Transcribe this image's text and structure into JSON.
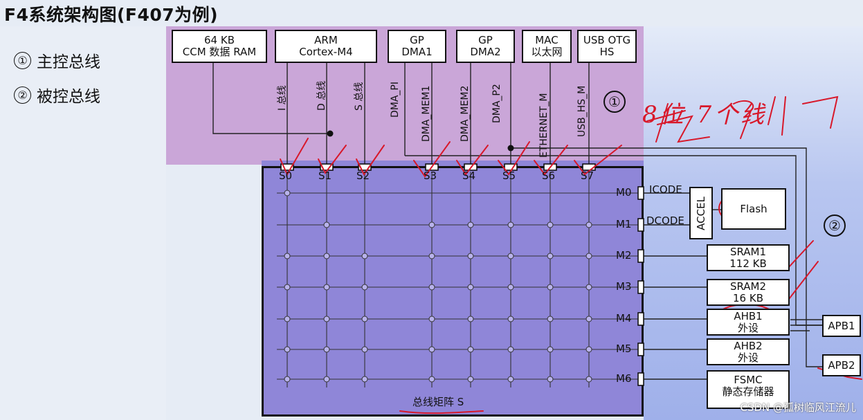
{
  "title": "F4系统架构图(F407为例)",
  "legend": [
    {
      "num": "①",
      "label": "主控总线"
    },
    {
      "num": "②",
      "label": "被控总线"
    }
  ],
  "masters": [
    {
      "line1": "64 KB",
      "line2": "CCM 数据 RAM"
    },
    {
      "line1": "ARM",
      "line2": "Cortex-M4"
    },
    {
      "line1": "GP",
      "line2": "DMA1"
    },
    {
      "line1": "GP",
      "line2": "DMA2"
    },
    {
      "line1": "MAC",
      "line2": "以太网"
    },
    {
      "line1": "USB OTG",
      "line2": "HS"
    }
  ],
  "master_buses": [
    "I 总线",
    "D 总线",
    "S 总线",
    "DMA_PI",
    "DMA_MEM1",
    "DMA_MEM2",
    "DMA_P2",
    "ETHERNET_M",
    "USB_HS_M"
  ],
  "region1_marker": "①",
  "region2_marker": "②",
  "slave_ports": [
    "S0",
    "S1",
    "S2",
    "S3",
    "S4",
    "S5",
    "S6",
    "S7"
  ],
  "master_ports": [
    "M0",
    "M1",
    "M2",
    "M3",
    "M4",
    "M5",
    "M6"
  ],
  "matrix_label": "总线矩阵 S",
  "icode": "ICODE",
  "dcode": "DCODE",
  "accel": "ACCEL",
  "flash": "Flash",
  "slaves": [
    {
      "line1": "SRAM1",
      "line2": "112 KB"
    },
    {
      "line1": "SRAM2",
      "line2": "16 KB"
    },
    {
      "line1": "AHB1",
      "line2": "外设"
    },
    {
      "line1": "AHB2",
      "line2": "外设"
    },
    {
      "line1": "FSMC",
      "line2": "静态存储器"
    }
  ],
  "apb": [
    "APB1",
    "APB2"
  ],
  "handwriting": "8位 7个线",
  "watermark": "CSDN @孤树临风江流儿",
  "colors": {
    "master_region": "#c9a4d8",
    "matrix": "#8f86d8",
    "annotation": "#d8182a"
  }
}
